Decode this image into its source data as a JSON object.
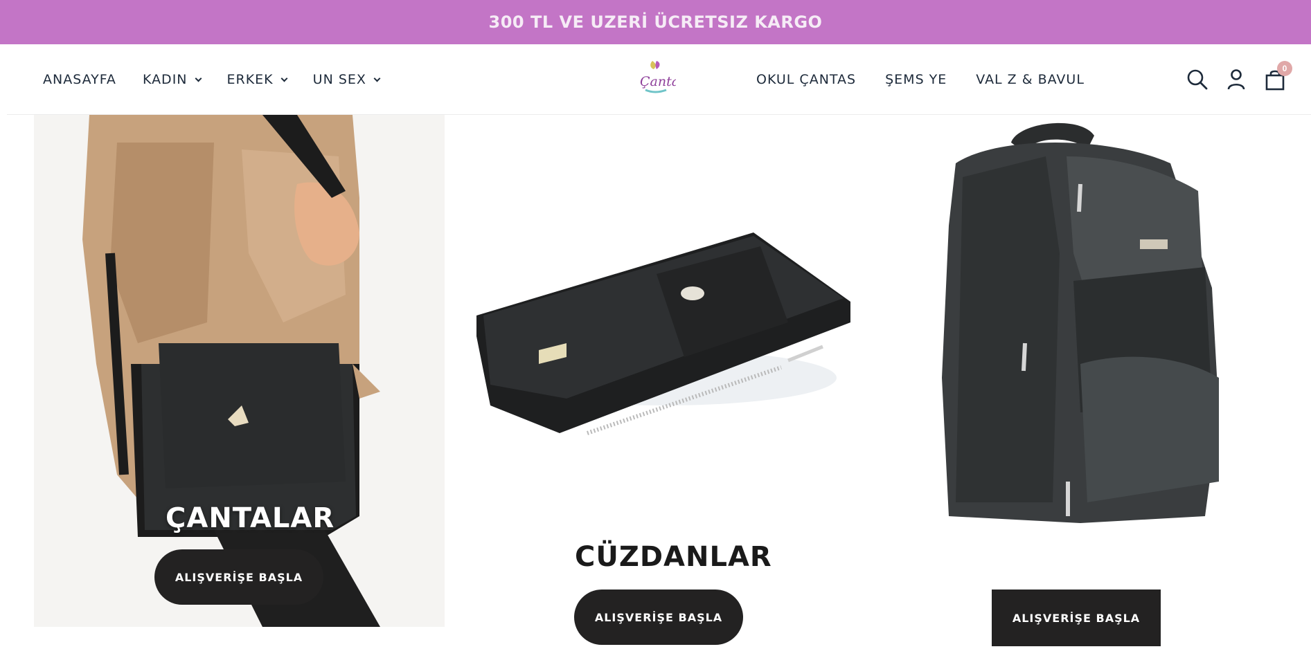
{
  "announcement": {
    "text": "300 TL VE UZERİ ÜCRETSIZ KARGO"
  },
  "nav_left": [
    {
      "label": "ANASAYFA"
    },
    {
      "label": "KADIN"
    },
    {
      "label": "ERKEK"
    },
    {
      "label": "UN SEX"
    }
  ],
  "nav_right": [
    {
      "label": "OKUL ÇANTAS"
    },
    {
      "label": "ŞEMS YE"
    },
    {
      "label": "VAL Z & BAVUL"
    }
  ],
  "header": {
    "logo_text": "Çanta",
    "cart_count": "0"
  },
  "cards": [
    {
      "title": "ÇANTALAR",
      "button": "ALIŞVERİŞE BAŞLA"
    },
    {
      "title": "CÜZDANLAR",
      "button": "ALIŞVERİŞE BAŞLA"
    },
    {
      "title": "",
      "button": "ALIŞVERİŞE BAŞLA"
    }
  ],
  "colors": {
    "announcement_bg": "#c375c6",
    "button_bg": "#232222",
    "nav_text": "#1d2a3a",
    "badge": "#e0a8a8"
  },
  "icons": [
    "search-icon",
    "user-icon",
    "shopping-bag-icon",
    "chevron-down-icon"
  ]
}
